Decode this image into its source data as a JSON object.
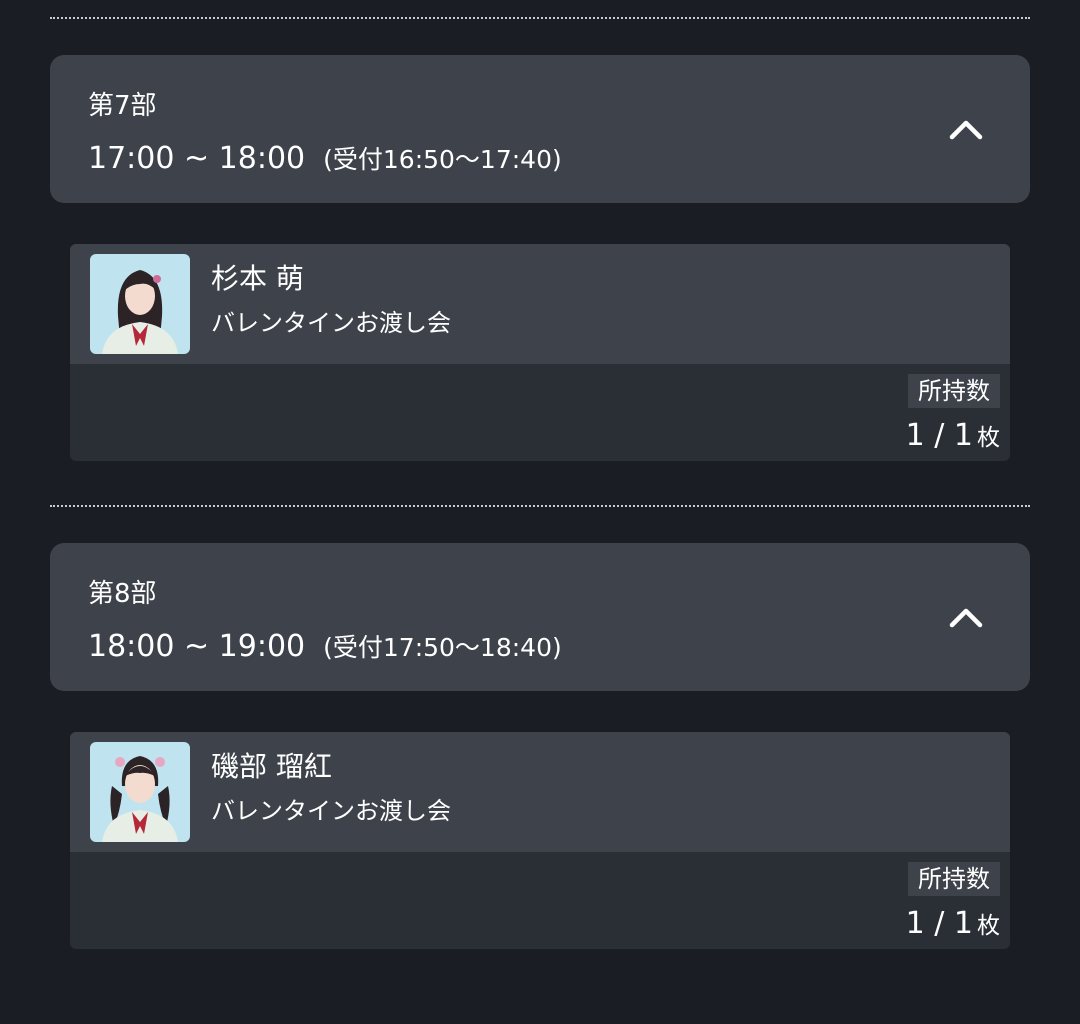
{
  "colors": {
    "background": "#1a1d23",
    "header_card": "#3e434b",
    "ticket_bottom": "#2a2e35",
    "divider": "#c9ccd2",
    "text": "#ffffff",
    "photo_bg": "#bfe3ef",
    "ribbon": "#b5283a"
  },
  "sessions": [
    {
      "part": "第7部",
      "time": "17:00 ~ 18:00",
      "reception": "(受付16:50〜17:40)",
      "expanded_icon": "chevron-up-icon",
      "ticket": {
        "member_name": "杉本 萌",
        "event_name": "バレンタインお渡し会",
        "holding_label": "所持数",
        "count": "1 / 1",
        "count_unit": "枚"
      }
    },
    {
      "part": "第8部",
      "time": "18:00 ~ 19:00",
      "reception": "(受付17:50〜18:40)",
      "expanded_icon": "chevron-up-icon",
      "ticket": {
        "member_name": "磯部 瑠紅",
        "event_name": "バレンタインお渡し会",
        "holding_label": "所持数",
        "count": "1 / 1",
        "count_unit": "枚"
      }
    }
  ]
}
